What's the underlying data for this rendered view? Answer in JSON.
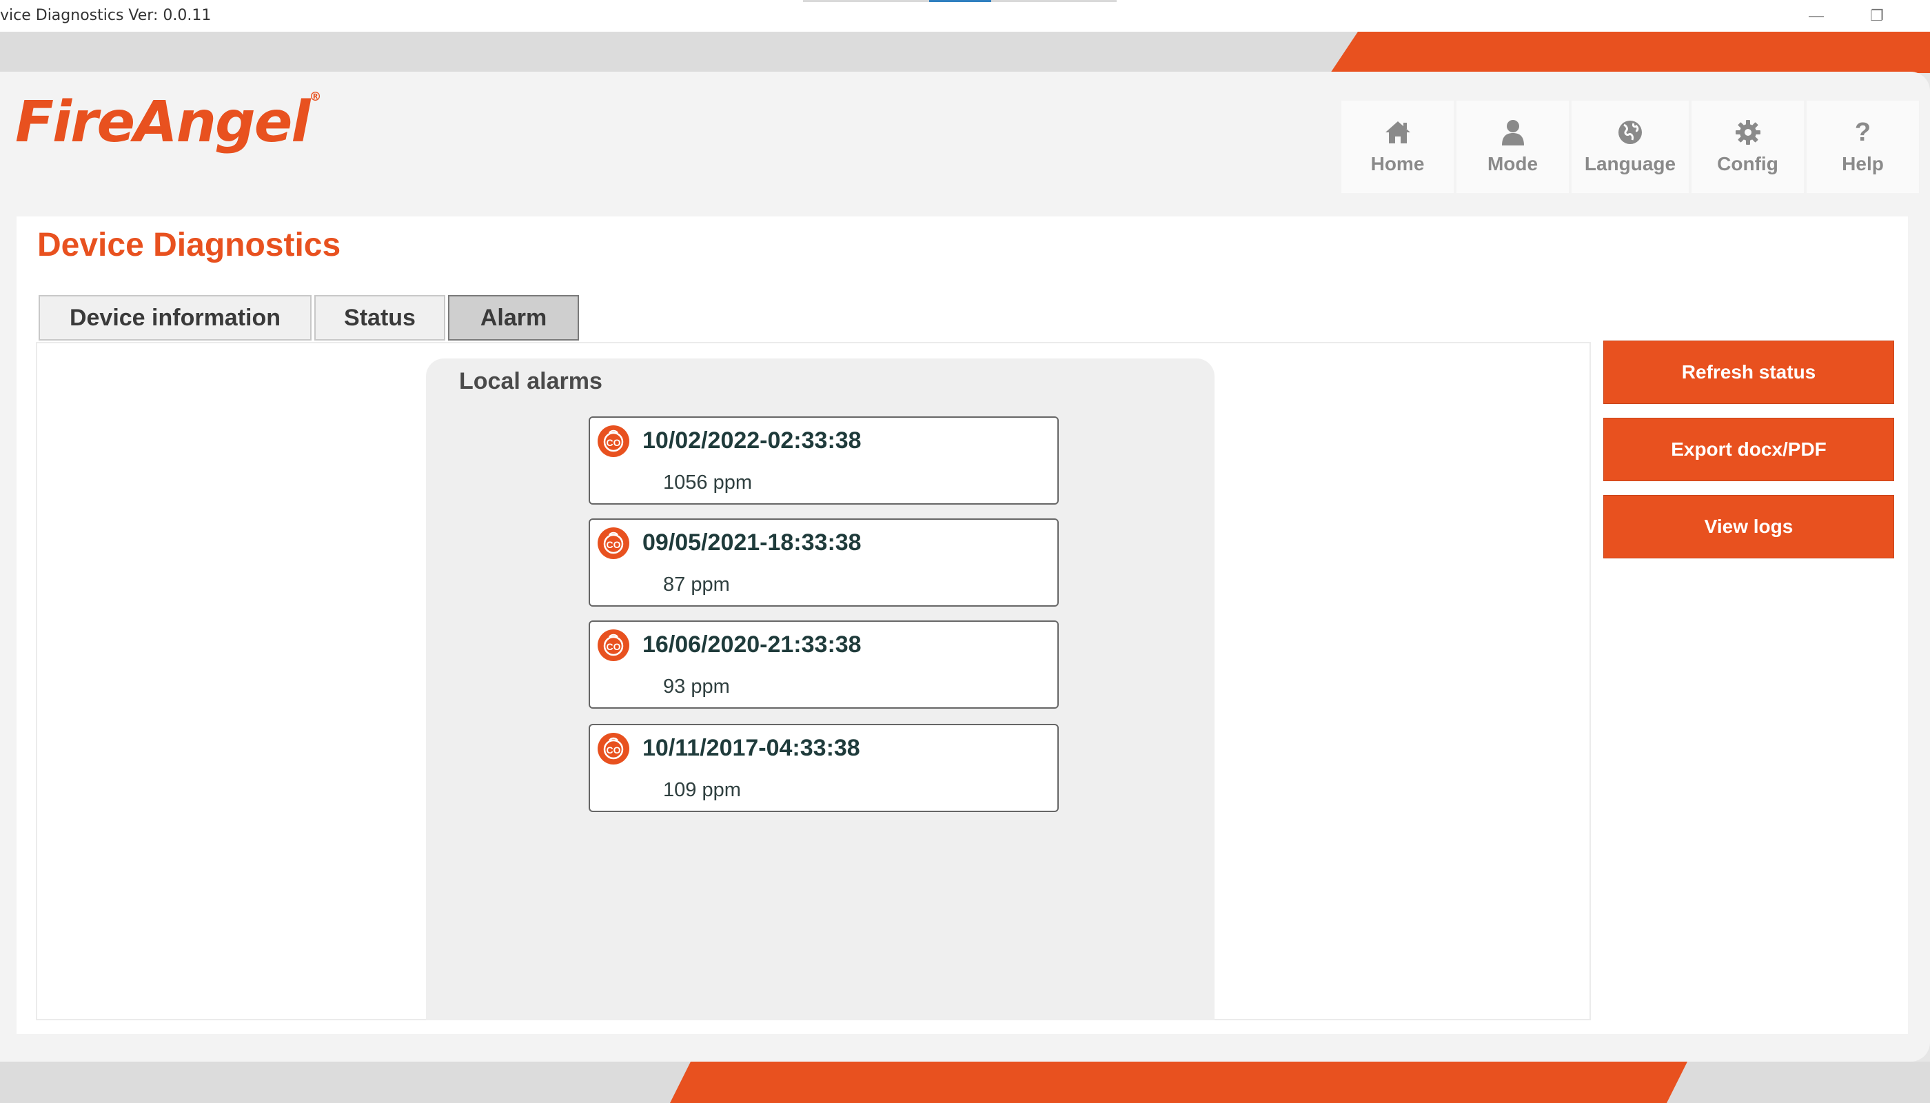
{
  "window": {
    "title": "vice Diagnostics Ver: 0.0.11",
    "minimize_glyph": "—",
    "restore_glyph": "❐"
  },
  "brand": {
    "logo_text": "FireAngel",
    "registered_mark": "®",
    "accent_color": "#e8511f"
  },
  "nav": {
    "items": [
      {
        "label": "Home",
        "icon": "home-icon"
      },
      {
        "label": "Mode",
        "icon": "user-icon"
      },
      {
        "label": "Language",
        "icon": "globe-icon"
      },
      {
        "label": "Config",
        "icon": "gear-icon"
      },
      {
        "label": "Help",
        "icon": "question-icon"
      }
    ]
  },
  "page": {
    "title": "Device Diagnostics"
  },
  "tabs": [
    {
      "label": "Device information",
      "active": false
    },
    {
      "label": "Status",
      "active": false
    },
    {
      "label": "Alarm",
      "active": true
    }
  ],
  "alarms": {
    "heading": "Local alarms",
    "icon": "co-alarm-icon",
    "items": [
      {
        "timestamp": "10/02/2022-02:33:38",
        "value": "1056 ppm"
      },
      {
        "timestamp": "09/05/2021-18:33:38",
        "value": "87 ppm"
      },
      {
        "timestamp": "16/06/2020-21:33:38",
        "value": "93 ppm"
      },
      {
        "timestamp": "10/11/2017-04:33:38",
        "value": "109 ppm"
      }
    ]
  },
  "actions": {
    "refresh": "Refresh status",
    "export": "Export docx/PDF",
    "logs": "View logs"
  }
}
